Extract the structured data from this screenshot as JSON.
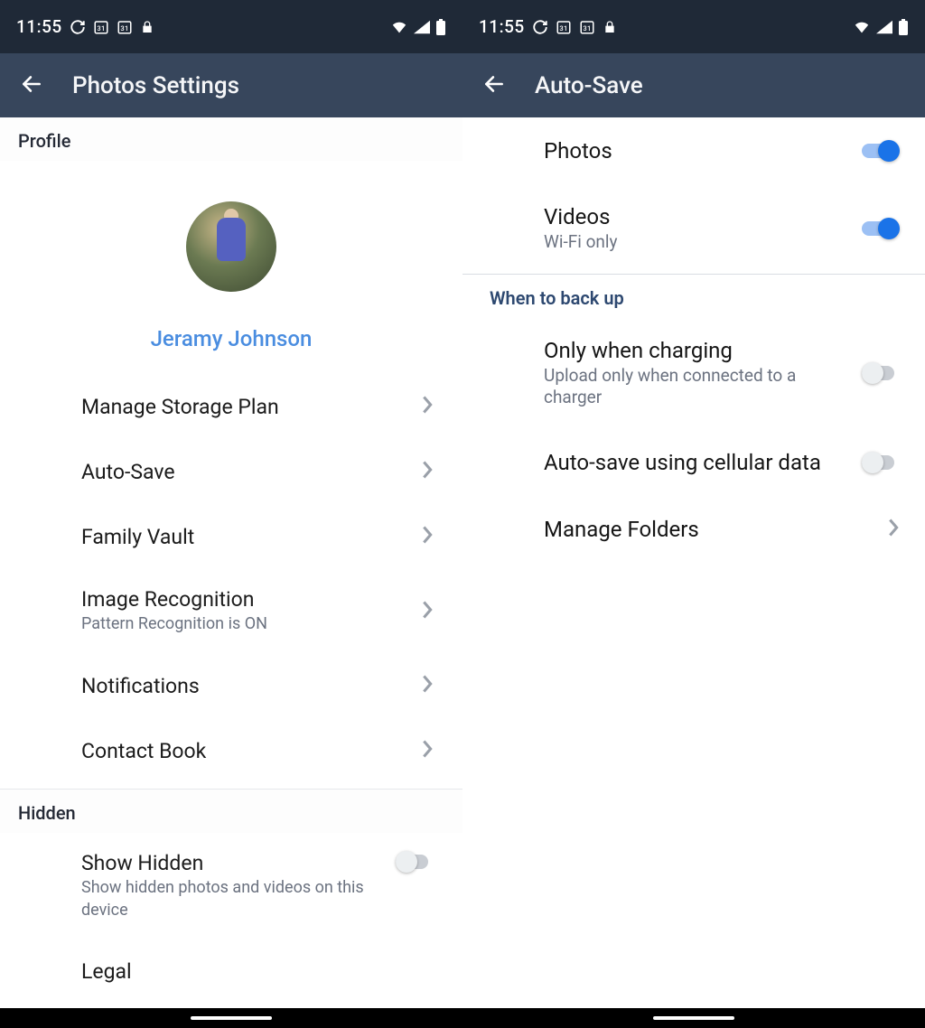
{
  "status": {
    "time": "11:55"
  },
  "left": {
    "title": "Photos Settings",
    "profile_section": "Profile",
    "profile_name": "Jeramy Johnson",
    "items": {
      "storage": "Manage Storage Plan",
      "autosave": "Auto-Save",
      "family": "Family Vault",
      "image_rec": "Image Recognition",
      "image_rec_sub": "Pattern Recognition is ON",
      "notifications": "Notifications",
      "contact": "Contact Book"
    },
    "hidden_section": "Hidden",
    "hidden": {
      "show_hidden": "Show Hidden",
      "show_hidden_sub": "Show hidden photos and videos on this device",
      "legal": "Legal"
    }
  },
  "right": {
    "title": "Auto-Save",
    "photos": "Photos",
    "videos": "Videos",
    "videos_sub": "Wi-Fi only",
    "when_section": "When to back up",
    "charging": "Only when charging",
    "charging_sub": "Upload only when connected to a charger",
    "cellular": "Auto-save using cellular data",
    "folders": "Manage Folders"
  }
}
